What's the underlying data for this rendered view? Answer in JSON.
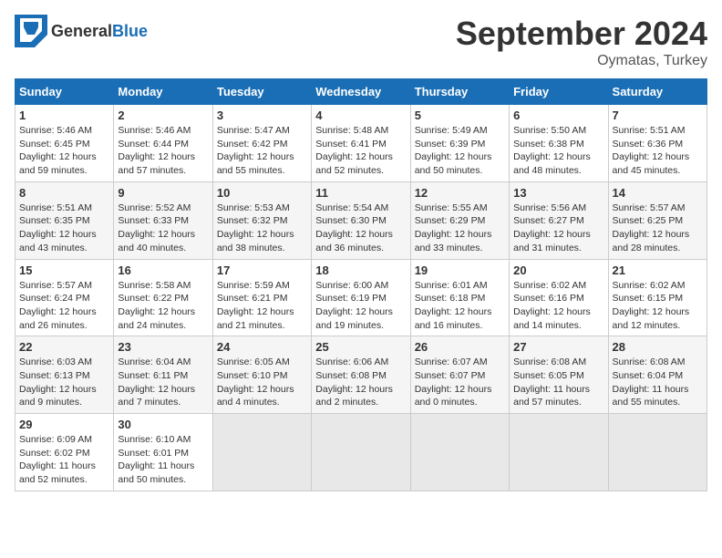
{
  "logo": {
    "general": "General",
    "blue": "Blue"
  },
  "title": "September 2024",
  "location": "Oymatas, Turkey",
  "headers": [
    "Sunday",
    "Monday",
    "Tuesday",
    "Wednesday",
    "Thursday",
    "Friday",
    "Saturday"
  ],
  "weeks": [
    [
      {
        "day": "1",
        "sunrise": "Sunrise: 5:46 AM",
        "sunset": "Sunset: 6:45 PM",
        "daylight": "Daylight: 12 hours and 59 minutes."
      },
      {
        "day": "2",
        "sunrise": "Sunrise: 5:46 AM",
        "sunset": "Sunset: 6:44 PM",
        "daylight": "Daylight: 12 hours and 57 minutes."
      },
      {
        "day": "3",
        "sunrise": "Sunrise: 5:47 AM",
        "sunset": "Sunset: 6:42 PM",
        "daylight": "Daylight: 12 hours and 55 minutes."
      },
      {
        "day": "4",
        "sunrise": "Sunrise: 5:48 AM",
        "sunset": "Sunset: 6:41 PM",
        "daylight": "Daylight: 12 hours and 52 minutes."
      },
      {
        "day": "5",
        "sunrise": "Sunrise: 5:49 AM",
        "sunset": "Sunset: 6:39 PM",
        "daylight": "Daylight: 12 hours and 50 minutes."
      },
      {
        "day": "6",
        "sunrise": "Sunrise: 5:50 AM",
        "sunset": "Sunset: 6:38 PM",
        "daylight": "Daylight: 12 hours and 48 minutes."
      },
      {
        "day": "7",
        "sunrise": "Sunrise: 5:51 AM",
        "sunset": "Sunset: 6:36 PM",
        "daylight": "Daylight: 12 hours and 45 minutes."
      }
    ],
    [
      {
        "day": "8",
        "sunrise": "Sunrise: 5:51 AM",
        "sunset": "Sunset: 6:35 PM",
        "daylight": "Daylight: 12 hours and 43 minutes."
      },
      {
        "day": "9",
        "sunrise": "Sunrise: 5:52 AM",
        "sunset": "Sunset: 6:33 PM",
        "daylight": "Daylight: 12 hours and 40 minutes."
      },
      {
        "day": "10",
        "sunrise": "Sunrise: 5:53 AM",
        "sunset": "Sunset: 6:32 PM",
        "daylight": "Daylight: 12 hours and 38 minutes."
      },
      {
        "day": "11",
        "sunrise": "Sunrise: 5:54 AM",
        "sunset": "Sunset: 6:30 PM",
        "daylight": "Daylight: 12 hours and 36 minutes."
      },
      {
        "day": "12",
        "sunrise": "Sunrise: 5:55 AM",
        "sunset": "Sunset: 6:29 PM",
        "daylight": "Daylight: 12 hours and 33 minutes."
      },
      {
        "day": "13",
        "sunrise": "Sunrise: 5:56 AM",
        "sunset": "Sunset: 6:27 PM",
        "daylight": "Daylight: 12 hours and 31 minutes."
      },
      {
        "day": "14",
        "sunrise": "Sunrise: 5:57 AM",
        "sunset": "Sunset: 6:25 PM",
        "daylight": "Daylight: 12 hours and 28 minutes."
      }
    ],
    [
      {
        "day": "15",
        "sunrise": "Sunrise: 5:57 AM",
        "sunset": "Sunset: 6:24 PM",
        "daylight": "Daylight: 12 hours and 26 minutes."
      },
      {
        "day": "16",
        "sunrise": "Sunrise: 5:58 AM",
        "sunset": "Sunset: 6:22 PM",
        "daylight": "Daylight: 12 hours and 24 minutes."
      },
      {
        "day": "17",
        "sunrise": "Sunrise: 5:59 AM",
        "sunset": "Sunset: 6:21 PM",
        "daylight": "Daylight: 12 hours and 21 minutes."
      },
      {
        "day": "18",
        "sunrise": "Sunrise: 6:00 AM",
        "sunset": "Sunset: 6:19 PM",
        "daylight": "Daylight: 12 hours and 19 minutes."
      },
      {
        "day": "19",
        "sunrise": "Sunrise: 6:01 AM",
        "sunset": "Sunset: 6:18 PM",
        "daylight": "Daylight: 12 hours and 16 minutes."
      },
      {
        "day": "20",
        "sunrise": "Sunrise: 6:02 AM",
        "sunset": "Sunset: 6:16 PM",
        "daylight": "Daylight: 12 hours and 14 minutes."
      },
      {
        "day": "21",
        "sunrise": "Sunrise: 6:02 AM",
        "sunset": "Sunset: 6:15 PM",
        "daylight": "Daylight: 12 hours and 12 minutes."
      }
    ],
    [
      {
        "day": "22",
        "sunrise": "Sunrise: 6:03 AM",
        "sunset": "Sunset: 6:13 PM",
        "daylight": "Daylight: 12 hours and 9 minutes."
      },
      {
        "day": "23",
        "sunrise": "Sunrise: 6:04 AM",
        "sunset": "Sunset: 6:11 PM",
        "daylight": "Daylight: 12 hours and 7 minutes."
      },
      {
        "day": "24",
        "sunrise": "Sunrise: 6:05 AM",
        "sunset": "Sunset: 6:10 PM",
        "daylight": "Daylight: 12 hours and 4 minutes."
      },
      {
        "day": "25",
        "sunrise": "Sunrise: 6:06 AM",
        "sunset": "Sunset: 6:08 PM",
        "daylight": "Daylight: 12 hours and 2 minutes."
      },
      {
        "day": "26",
        "sunrise": "Sunrise: 6:07 AM",
        "sunset": "Sunset: 6:07 PM",
        "daylight": "Daylight: 12 hours and 0 minutes."
      },
      {
        "day": "27",
        "sunrise": "Sunrise: 6:08 AM",
        "sunset": "Sunset: 6:05 PM",
        "daylight": "Daylight: 11 hours and 57 minutes."
      },
      {
        "day": "28",
        "sunrise": "Sunrise: 6:08 AM",
        "sunset": "Sunset: 6:04 PM",
        "daylight": "Daylight: 11 hours and 55 minutes."
      }
    ],
    [
      {
        "day": "29",
        "sunrise": "Sunrise: 6:09 AM",
        "sunset": "Sunset: 6:02 PM",
        "daylight": "Daylight: 11 hours and 52 minutes."
      },
      {
        "day": "30",
        "sunrise": "Sunrise: 6:10 AM",
        "sunset": "Sunset: 6:01 PM",
        "daylight": "Daylight: 11 hours and 50 minutes."
      },
      null,
      null,
      null,
      null,
      null
    ]
  ]
}
